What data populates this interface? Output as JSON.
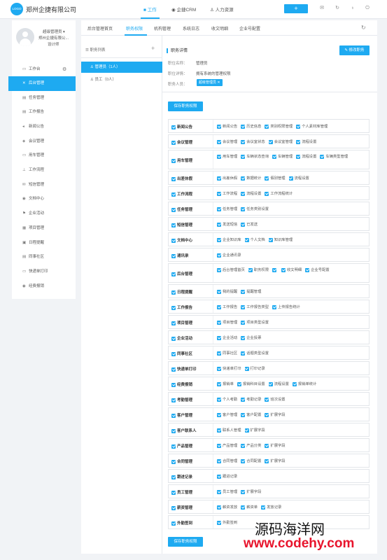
{
  "topbar": {
    "logo_text": "LOGO",
    "company": "郑州企捷有限公司",
    "nav": [
      {
        "label": "■ 工作",
        "active": true
      },
      {
        "label": "◉ 企捷CRM",
        "active": false
      },
      {
        "label": "♙ 人力资源",
        "active": false
      }
    ],
    "add_label": "+",
    "icons": [
      "mail-icon",
      "refresh-icon",
      "bulb-icon",
      "power-icon"
    ]
  },
  "user": {
    "name": "超级管理员 ▾",
    "company": "郑州企捷有限公...",
    "role": "设计师"
  },
  "sidebar": {
    "items": [
      {
        "icon": "▭",
        "label": "工作台",
        "name": "sidebar-item-workbench"
      },
      {
        "icon": "✕",
        "label": "后台管理",
        "name": "sidebar-item-admin",
        "active": true
      },
      {
        "icon": "▤",
        "label": "任务管理",
        "name": "sidebar-item-tasks"
      },
      {
        "icon": "▤",
        "label": "工作报告",
        "name": "sidebar-item-reports"
      },
      {
        "icon": "◂",
        "label": "新闻公告",
        "name": "sidebar-item-news"
      },
      {
        "icon": "◈",
        "label": "会议管理",
        "name": "sidebar-item-meetings"
      },
      {
        "icon": "▭",
        "label": "用车管理",
        "name": "sidebar-item-vehicles"
      },
      {
        "icon": "⊥",
        "label": "工作流程",
        "name": "sidebar-item-workflow"
      },
      {
        "icon": "✉",
        "label": "短信管理",
        "name": "sidebar-item-sms"
      },
      {
        "icon": "◉",
        "label": "文档中心",
        "name": "sidebar-item-docs"
      },
      {
        "icon": "⚑",
        "label": "企业活动",
        "name": "sidebar-item-activities"
      },
      {
        "icon": "▦",
        "label": "项目管理",
        "name": "sidebar-item-projects"
      },
      {
        "icon": "▣",
        "label": "日程提醒",
        "name": "sidebar-item-schedule"
      },
      {
        "icon": "▤",
        "label": "同事社区",
        "name": "sidebar-item-community"
      },
      {
        "icon": "▭",
        "label": "快递单打印",
        "name": "sidebar-item-express"
      },
      {
        "icon": "◉",
        "label": "经费报销",
        "name": "sidebar-item-expenses"
      }
    ]
  },
  "tabs": [
    "后台管理首页",
    "职务权限",
    "机构管理",
    "系统日志",
    "收文明细",
    "企业号配置"
  ],
  "roles_panel": {
    "title": "☰ 职务列表",
    "plus": "+",
    "roles": [
      {
        "label": "管理员（1人）",
        "active": true
      },
      {
        "label": "员工（0人）",
        "active": false
      }
    ]
  },
  "detail": {
    "title": "职务详情",
    "edit_label": "✎ 修改职务",
    "rows": [
      {
        "key": "职位名称：",
        "value": "管理员"
      },
      {
        "key": "职位详情：",
        "value": "拥有系统的管理权限"
      },
      {
        "key": "职务人员：",
        "value": ""
      }
    ],
    "member_tag": "超级管理员 ✕",
    "save_label": "保存职务权限"
  },
  "permissions": [
    {
      "module": "新闻公告",
      "options": [
        "新闻公告",
        "历史信息",
        "类别权限管理",
        "个人素材库管理"
      ]
    },
    {
      "module": "会议管理",
      "options": [
        "会议管理",
        "会议室状态",
        "会议室管理",
        "流程设置"
      ]
    },
    {
      "module": "用车管理",
      "options": [
        "用车管理",
        "车辆状态查询",
        "车辆管理",
        "流程设置",
        "车辆类型管理"
      ]
    },
    {
      "module": "出差休假",
      "options": [
        "出差休假",
        "数据统计",
        "假别管理",
        "流程设置"
      ]
    },
    {
      "module": "工作流程",
      "options": [
        "工作流程",
        "流程设置",
        "工作流程统计"
      ]
    },
    {
      "module": "任务管理",
      "options": [
        "任务管理",
        "任务类别设置"
      ]
    },
    {
      "module": "短信管理",
      "options": [
        "发送短信",
        "已发送"
      ]
    },
    {
      "module": "文档中心",
      "options": [
        "企业知识库",
        "个人文档",
        "知识库管理"
      ]
    },
    {
      "module": "通讯录",
      "options": [
        "企业通讯录"
      ]
    },
    {
      "module": "后台管理",
      "options": [
        "后台管理首页",
        "职务权限",
        "",
        "收文明细",
        "企业号配置"
      ]
    },
    {
      "module": "日程提醒",
      "options": [
        "我的提醒",
        "提醒管理"
      ]
    },
    {
      "module": "工作报告",
      "options": [
        "工作报告",
        "工作报告类型",
        "上传报告统计"
      ]
    },
    {
      "module": "项目管理",
      "options": [
        "项目管理",
        "项目类型设置"
      ]
    },
    {
      "module": "企业活动",
      "options": [
        "企业活动",
        "企业投票"
      ]
    },
    {
      "module": "同事社区",
      "options": [
        "同事社区",
        "话题类型设置"
      ]
    },
    {
      "module": "快递单打印",
      "options": [
        "快递单打印",
        "打印记录"
      ]
    },
    {
      "module": "经费报销",
      "options": [
        "报销单",
        "报销科目设置",
        "流程设置",
        "报销单统计"
      ]
    },
    {
      "module": "考勤管理",
      "options": [
        "个人考勤",
        "考勤记录",
        "班次设置"
      ]
    },
    {
      "module": "客户管理",
      "options": [
        "客户管理",
        "客户配置",
        "扩展字段"
      ]
    },
    {
      "module": "客户联系人",
      "options": [
        "联系人管理",
        "扩展字段"
      ]
    },
    {
      "module": "产品管理",
      "options": [
        "产品管理",
        "产品分类",
        "扩展字段"
      ]
    },
    {
      "module": "合同管理",
      "options": [
        "合同管理",
        "合同配置",
        "扩展字段"
      ]
    },
    {
      "module": "跟进记录",
      "options": [
        "跟进记录"
      ]
    },
    {
      "module": "员工管理",
      "options": [
        "员工管理",
        "扩展字段"
      ]
    },
    {
      "module": "薪资管理",
      "options": [
        "薪资发放",
        "薪资单",
        "发放记录"
      ]
    },
    {
      "module": "外勤签到",
      "options": [
        "外勤签到"
      ]
    }
  ],
  "watermark": {
    "line1": "源码海洋网",
    "line2": "www.codehy.com"
  }
}
